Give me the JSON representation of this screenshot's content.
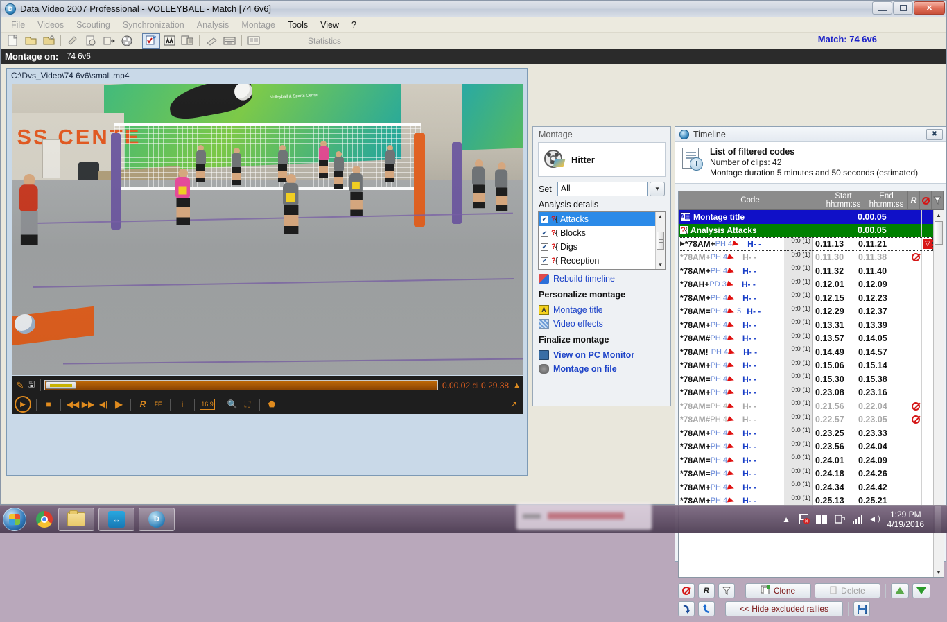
{
  "window": {
    "title": "Data Video 2007 Professional - VOLLEYBALL - Match [74 6v6]",
    "icon": "app-icon"
  },
  "menu": [
    {
      "label": "File",
      "enabled": false
    },
    {
      "label": "Videos",
      "enabled": false
    },
    {
      "label": "Scouting",
      "enabled": false
    },
    {
      "label": "Synchronization",
      "enabled": false
    },
    {
      "label": "Analysis",
      "enabled": false
    },
    {
      "label": "Montage",
      "enabled": false
    },
    {
      "label": "Tools",
      "enabled": true
    },
    {
      "label": "View",
      "enabled": true
    },
    {
      "label": "?",
      "enabled": true
    }
  ],
  "toolbar": {
    "statistics_label": "Statistics",
    "match_label": "Match: 74 6v6",
    "icons": [
      "new-file-icon",
      "open-folder-icon",
      "open-video-icon",
      "edit-icon",
      "clock-file-icon",
      "export-icon",
      "film-reel-icon",
      "checklist-icon",
      "players-icon",
      "building-icon",
      "brush-icon",
      "keyboard-icon",
      "report-icon"
    ]
  },
  "status_bar": {
    "label": "Montage on:",
    "value": "74 6v6"
  },
  "video": {
    "path": "C:\\Dvs_Video\\74 6v6\\small.mp4",
    "time_text": "0.00.02 di 0.29.38",
    "controls": [
      "play-icon",
      "stop-icon",
      "rewind-icon",
      "fast-forward-icon",
      "prev-frame-icon",
      "next-frame-icon",
      "rally-icon",
      "fast-forward-ff-icon",
      "info-icon",
      "aspect-16-9-icon",
      "zoom-icon",
      "fullscreen-icon",
      "snapshot-icon"
    ],
    "seek_icons": [
      "pen-icon",
      "save-icon"
    ],
    "eject_icon": "eject-icon",
    "expand_icon": "expand-icon"
  },
  "montage": {
    "panel_title": "Montage",
    "preset_name": "Hitter",
    "set_label": "Set",
    "set_value": "All",
    "analysis_details_label": "Analysis details",
    "analysis_items": [
      {
        "label": "Attacks",
        "checked": true,
        "selected": true
      },
      {
        "label": "Blocks",
        "checked": true,
        "selected": false
      },
      {
        "label": "Digs",
        "checked": true,
        "selected": false
      },
      {
        "label": "Reception",
        "checked": true,
        "selected": false
      }
    ],
    "rebuild_label": "Rebuild timeline",
    "personalize_header": "Personalize montage",
    "personalize_items": [
      {
        "label": "Montage title",
        "icon": "title-icon"
      },
      {
        "label": "Video effects",
        "icon": "effects-icon"
      }
    ],
    "finalize_header": "Finalize montage",
    "finalize_items": [
      {
        "label": "View on PC Monitor",
        "icon": "monitor-icon"
      },
      {
        "label": "Montage on file",
        "icon": "file-icon"
      }
    ]
  },
  "timeline": {
    "panel_title": "Timeline",
    "close_label": "✖",
    "info_title": "List of filtered codes",
    "info_clips": "Number of clips: 42",
    "info_duration": "Montage duration 5 minutes and 50 seconds (estimated)",
    "columns": {
      "code": "Code",
      "start": "Start",
      "start_sub": "hh:mm:ss",
      "end": "End",
      "end_sub": "hh:mm:ss",
      "r": "R",
      "ban": "ban-icon",
      "filter": "filter-icon"
    },
    "rows": [
      {
        "type": "title",
        "code": "Montage title",
        "start": "",
        "end": "0.00.05",
        "dur": "",
        "excluded": false,
        "flag": "",
        "ban": false,
        "focus": false
      },
      {
        "type": "analysis",
        "code": "Analysis Attacks",
        "start": "",
        "end": "0.00.05",
        "dur": "",
        "excluded": false,
        "flag": "",
        "ban": false,
        "focus": false
      },
      {
        "type": "clip",
        "code": "*78AM+",
        "sub": "PH 4",
        "h": "H- -",
        "dur": "0:0 (1)",
        "start": "0.11.13",
        "end": "0.11.21",
        "excluded": false,
        "ban": false,
        "flag": "filter",
        "focus": true
      },
      {
        "type": "clip",
        "code": "*78AM+",
        "sub": "PH 4",
        "h": "H- -",
        "dur": "0:0 (1)",
        "start": "0.11.30",
        "end": "0.11.38",
        "excluded": true,
        "ban": true,
        "flag": "",
        "focus": false
      },
      {
        "type": "clip",
        "code": "*78AM+",
        "sub": "PH 4",
        "h": "H- -",
        "dur": "0:0 (1)",
        "start": "0.11.32",
        "end": "0.11.40",
        "excluded": false,
        "ban": false,
        "flag": "",
        "focus": false
      },
      {
        "type": "clip",
        "code": "*78AH+",
        "sub": "PD 3",
        "h": "H- -",
        "dur": "0:0 (1)",
        "start": "0.12.01",
        "end": "0.12.09",
        "excluded": false,
        "ban": false,
        "flag": "",
        "focus": false
      },
      {
        "type": "clip",
        "code": "*78AM+",
        "sub": "PH 4",
        "h": "H- -",
        "dur": "0:0 (1)",
        "start": "0.12.15",
        "end": "0.12.23",
        "excluded": false,
        "ban": false,
        "flag": "",
        "focus": false
      },
      {
        "type": "clip",
        "code": "*78AM=",
        "sub": "PH 4",
        "sub2": "5",
        "h": "H- -",
        "dur": "0:0 (1)",
        "start": "0.12.29",
        "end": "0.12.37",
        "excluded": false,
        "ban": false,
        "flag": "",
        "focus": false
      },
      {
        "type": "clip",
        "code": "*78AM+",
        "sub": "PH 4",
        "h": "H- -",
        "dur": "0:0 (1)",
        "start": "0.13.31",
        "end": "0.13.39",
        "excluded": false,
        "ban": false,
        "flag": "",
        "focus": false
      },
      {
        "type": "clip",
        "code": "*78AM#",
        "sub": "PH 4",
        "h": "H- -",
        "dur": "0:0 (1)",
        "start": "0.13.57",
        "end": "0.14.05",
        "excluded": false,
        "ban": false,
        "flag": "",
        "focus": false
      },
      {
        "type": "clip",
        "code": "*78AM!",
        "sub": "PH 4",
        "h": "H- -",
        "dur": "0:0 (1)",
        "start": "0.14.49",
        "end": "0.14.57",
        "excluded": false,
        "ban": false,
        "flag": "",
        "focus": false
      },
      {
        "type": "clip",
        "code": "*78AM+",
        "sub": "PH 4",
        "h": "H- -",
        "dur": "0:0 (1)",
        "start": "0.15.06",
        "end": "0.15.14",
        "excluded": false,
        "ban": false,
        "flag": "",
        "focus": false
      },
      {
        "type": "clip",
        "code": "*78AM=",
        "sub": "PH 4",
        "h": "H- -",
        "dur": "0:0 (1)",
        "start": "0.15.30",
        "end": "0.15.38",
        "excluded": false,
        "ban": false,
        "flag": "",
        "focus": false
      },
      {
        "type": "clip",
        "code": "*78AM+",
        "sub": "PH 4",
        "h": "H- -",
        "dur": "0:0 (1)",
        "start": "0.23.08",
        "end": "0.23.16",
        "excluded": false,
        "ban": false,
        "flag": "",
        "focus": false
      },
      {
        "type": "clip",
        "code": "*78AM=",
        "sub": "PH 4",
        "h": "H- -",
        "dur": "0:0 (1)",
        "start": "0.21.56",
        "end": "0.22.04",
        "excluded": true,
        "ban": true,
        "flag": "",
        "focus": false
      },
      {
        "type": "clip",
        "code": "*78AM#",
        "sub": "PH 4",
        "h": "H- -",
        "dur": "0:0 (1)",
        "start": "0.22.57",
        "end": "0.23.05",
        "excluded": true,
        "ban": true,
        "flag": "",
        "focus": false
      },
      {
        "type": "clip",
        "code": "*78AM+",
        "sub": "PH 4",
        "h": "H- -",
        "dur": "0:0 (1)",
        "start": "0.23.25",
        "end": "0.23.33",
        "excluded": false,
        "ban": false,
        "flag": "",
        "focus": false
      },
      {
        "type": "clip",
        "code": "*78AM+",
        "sub": "PH 4",
        "h": "H- -",
        "dur": "0:0 (1)",
        "start": "0.23.56",
        "end": "0.24.04",
        "excluded": false,
        "ban": false,
        "flag": "",
        "focus": false
      },
      {
        "type": "clip",
        "code": "*78AM=",
        "sub": "PH 4",
        "h": "H- -",
        "dur": "0:0 (1)",
        "start": "0.24.01",
        "end": "0.24.09",
        "excluded": false,
        "ban": false,
        "flag": "",
        "focus": false
      },
      {
        "type": "clip",
        "code": "*78AM=",
        "sub": "PH 4",
        "h": "H- -",
        "dur": "0:0 (1)",
        "start": "0.24.18",
        "end": "0.24.26",
        "excluded": false,
        "ban": false,
        "flag": "",
        "focus": false
      },
      {
        "type": "clip",
        "code": "*78AM+",
        "sub": "PH 4",
        "h": "H- -",
        "dur": "0:0 (1)",
        "start": "0.24.34",
        "end": "0.24.42",
        "excluded": false,
        "ban": false,
        "flag": "",
        "focus": false
      },
      {
        "type": "clip",
        "code": "*78AM+",
        "sub": "PH 4",
        "h": "H- -",
        "dur": "0:0 (1)",
        "start": "0.25.13",
        "end": "0.25.21",
        "excluded": false,
        "ban": false,
        "flag": "",
        "focus": false
      }
    ],
    "bottom_toolbar": {
      "exclude_label": "ban-icon",
      "rally_label": "R",
      "filter_label": "filter-icon",
      "clone_label": "Clone",
      "delete_label": "Delete",
      "hide_label": "<< Hide excluded rallies",
      "move_up": "up-arrow-icon",
      "move_down": "down-arrow-icon",
      "down_arrow": "curve-down-icon",
      "up_arrow": "curve-up-icon",
      "save": "save-icon"
    }
  },
  "taskbar": {
    "start": "start-orb",
    "apps": [
      "chrome-icon",
      "explorer-icon",
      "teamviewer-icon",
      "datavideo-icon"
    ],
    "tray_icons": [
      "show-hidden-icon",
      "network-flag-icon",
      "windows-icon",
      "action-center-icon",
      "signal-icon",
      "volume-icon"
    ],
    "time": "1:29 PM",
    "date": "4/19/2016"
  },
  "colors": {
    "title_row": "#1010c8",
    "analysis_row": "#008000",
    "accent_link": "#1d43c8",
    "orange": "#e2601e",
    "selected": "#2b8ae8"
  }
}
